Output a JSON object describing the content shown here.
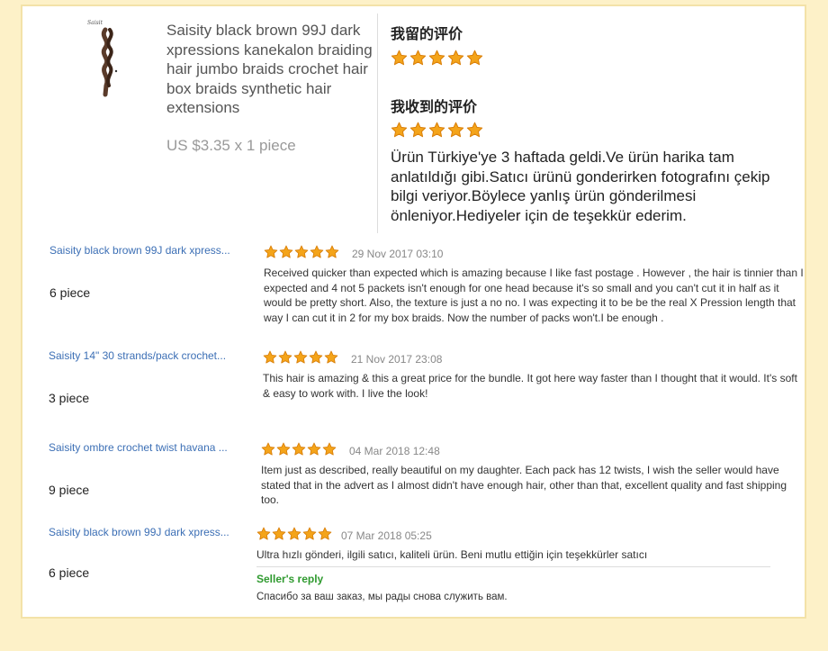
{
  "colors": {
    "star": "#f4a41a",
    "star_edge": "#d97f0a",
    "link": "#3c6fb5",
    "reply": "#2f9a2f",
    "background": "#fdf1c8"
  },
  "product": {
    "title": "Saisity black brown 99J dark xpressions kanekalon braiding hair jumbo braids crochet hair box braids synthetic hair extensions",
    "price": "US $3.35 x 1 piece",
    "thumb_brand": "Saisit"
  },
  "my_review": {
    "heading": "我留的评价",
    "stars": 5
  },
  "received_review": {
    "heading": "我收到的评价",
    "stars": 5,
    "text": "Ürün Türkiye'ye 3 haftada geldi.Ve ürün harika tam anlatıldığı gibi.Satıcı ürünü gonderirken fotografını çekip bilgi veriyor.Böylece yanlış ürün gönderilmesi önleniyor.Hediyeler için de teşekkür ederim."
  },
  "reviews": [
    {
      "product": "Saisity black brown 99J dark xpress...",
      "qty": "6 piece",
      "stars": 5,
      "date": "29 Nov 2017 03:10",
      "text": "Received quicker than expected which is amazing because I like fast postage . However , the hair is tinnier than I expected and 4 not 5 packets isn't enough for one head because it's so small and you can't cut it in half as it would be pretty short. Also, the texture is just a no no. I was expecting it to be be the real X Pression length that way I can cut it in 2 for my box braids. Now the number of packs won't.I be enough ."
    },
    {
      "product": "Saisity 14\" 30 strands/pack crochet...",
      "qty": "3 piece",
      "stars": 5,
      "date": "21 Nov 2017 23:08",
      "text": "This hair is amazing & this a great price for the bundle. It got here way faster than I thought that it would. It's soft & easy to work with. I live the look!"
    },
    {
      "product": "Saisity ombre crochet twist havana ...",
      "qty": "9 piece",
      "stars": 5,
      "date": "04 Mar 2018 12:48",
      "text": "Item just as described, really beautiful on my daughter. Each pack has 12 twists, I wish the seller would have stated that in the advert as I almost didn't have enough hair, other than that, excellent quality and fast shipping too."
    },
    {
      "product": "Saisity black brown 99J dark xpress...",
      "qty": "6 piece",
      "stars": 5,
      "date": "07 Mar 2018 05:25",
      "text": "Ultra hızlı gönderi, ilgili satıcı, kaliteli ürün. Beni mutlu ettiğin için teşekkürler satıcı",
      "reply_label": "Seller's reply",
      "reply_text": "Спасибо за ваш заказ, мы рады снова служить вам."
    }
  ]
}
